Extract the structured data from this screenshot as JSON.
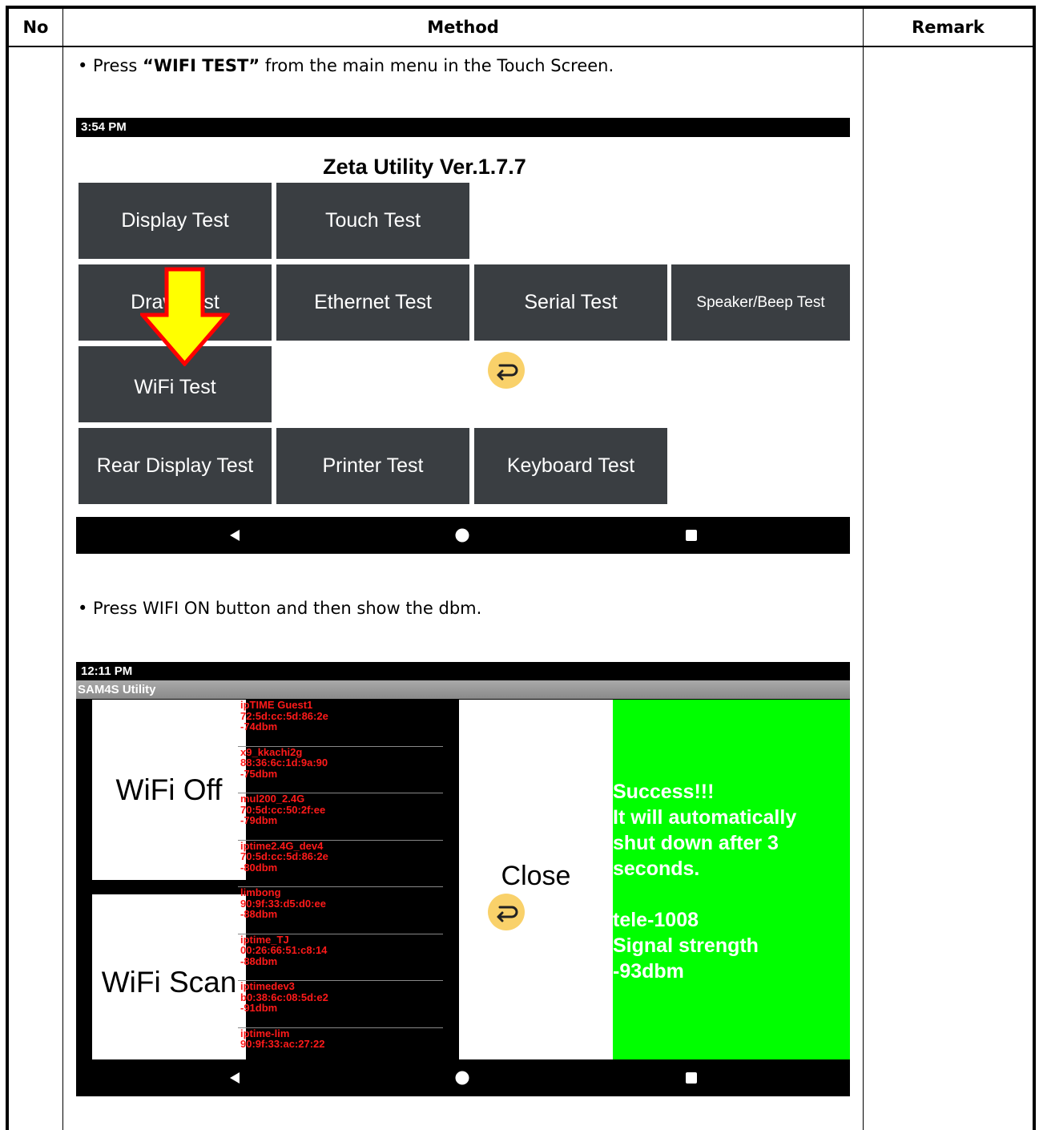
{
  "table": {
    "headers": {
      "no": "No",
      "method": "Method",
      "remark": "Remark"
    }
  },
  "step1": {
    "bullet_prefix": "• Press ",
    "bullet_bold": "“WIFI TEST”",
    "bullet_suffix": " from the main menu in the Touch Screen.",
    "screen": {
      "time": "3:54 PM",
      "title": "Zeta Utility Ver.1.7.7",
      "tiles": [
        "Display Test",
        "Touch Test",
        "Draw Test",
        "Ethernet Test",
        "Serial Test",
        "Speaker/Beep Test",
        "WiFi Test",
        "Rear Display Test",
        "Printer Test",
        "Keyboard Test"
      ]
    }
  },
  "step2": {
    "bullet": "• Press WIFI ON button and then show the dbm.",
    "screen": {
      "time": "12:11 PM",
      "app_title": "SAM4S Utility",
      "wifi_off_label": "WiFi Off",
      "wifi_scan_label": "WiFi Scan",
      "close_label": "Close",
      "networks": [
        {
          "ssid": "ipTIME Guest1",
          "mac": "72:5d:cc:5d:86:2e",
          "dbm": "-74dbm"
        },
        {
          "ssid": "x9_kkachi2g",
          "mac": "88:36:6c:1d:9a:90",
          "dbm": "-75dbm"
        },
        {
          "ssid": "mul200_2.4G",
          "mac": "70:5d:cc:50:2f:ee",
          "dbm": "-79dbm"
        },
        {
          "ssid": "iptime2.4G_dev4",
          "mac": "70:5d:cc:5d:86:2e",
          "dbm": "-80dbm"
        },
        {
          "ssid": "limbong",
          "mac": "90:9f:33:d5:d0:ee",
          "dbm": "-88dbm"
        },
        {
          "ssid": "iptime_TJ",
          "mac": "00:26:66:51:c8:14",
          "dbm": "-88dbm"
        },
        {
          "ssid": "iptimedev3",
          "mac": "b0:38:6c:08:5d:e2",
          "dbm": "-91dbm"
        },
        {
          "ssid": "iptime-lim",
          "mac": "90:9f:33:ac:27:22",
          "dbm": ""
        }
      ],
      "result_message": "Success!!!\nIt will automatically\nshut down after 3\nseconds.\n\ntele-1008\nSignal strength\n-93dbm"
    }
  },
  "colors": {
    "tile": "#3a3e42",
    "arrow_fill": "#ffff00",
    "arrow_outline": "#ff0000",
    "network_text": "#ff1a1a",
    "success_bg": "#00ff00",
    "return_badge": "#f9d16a"
  }
}
